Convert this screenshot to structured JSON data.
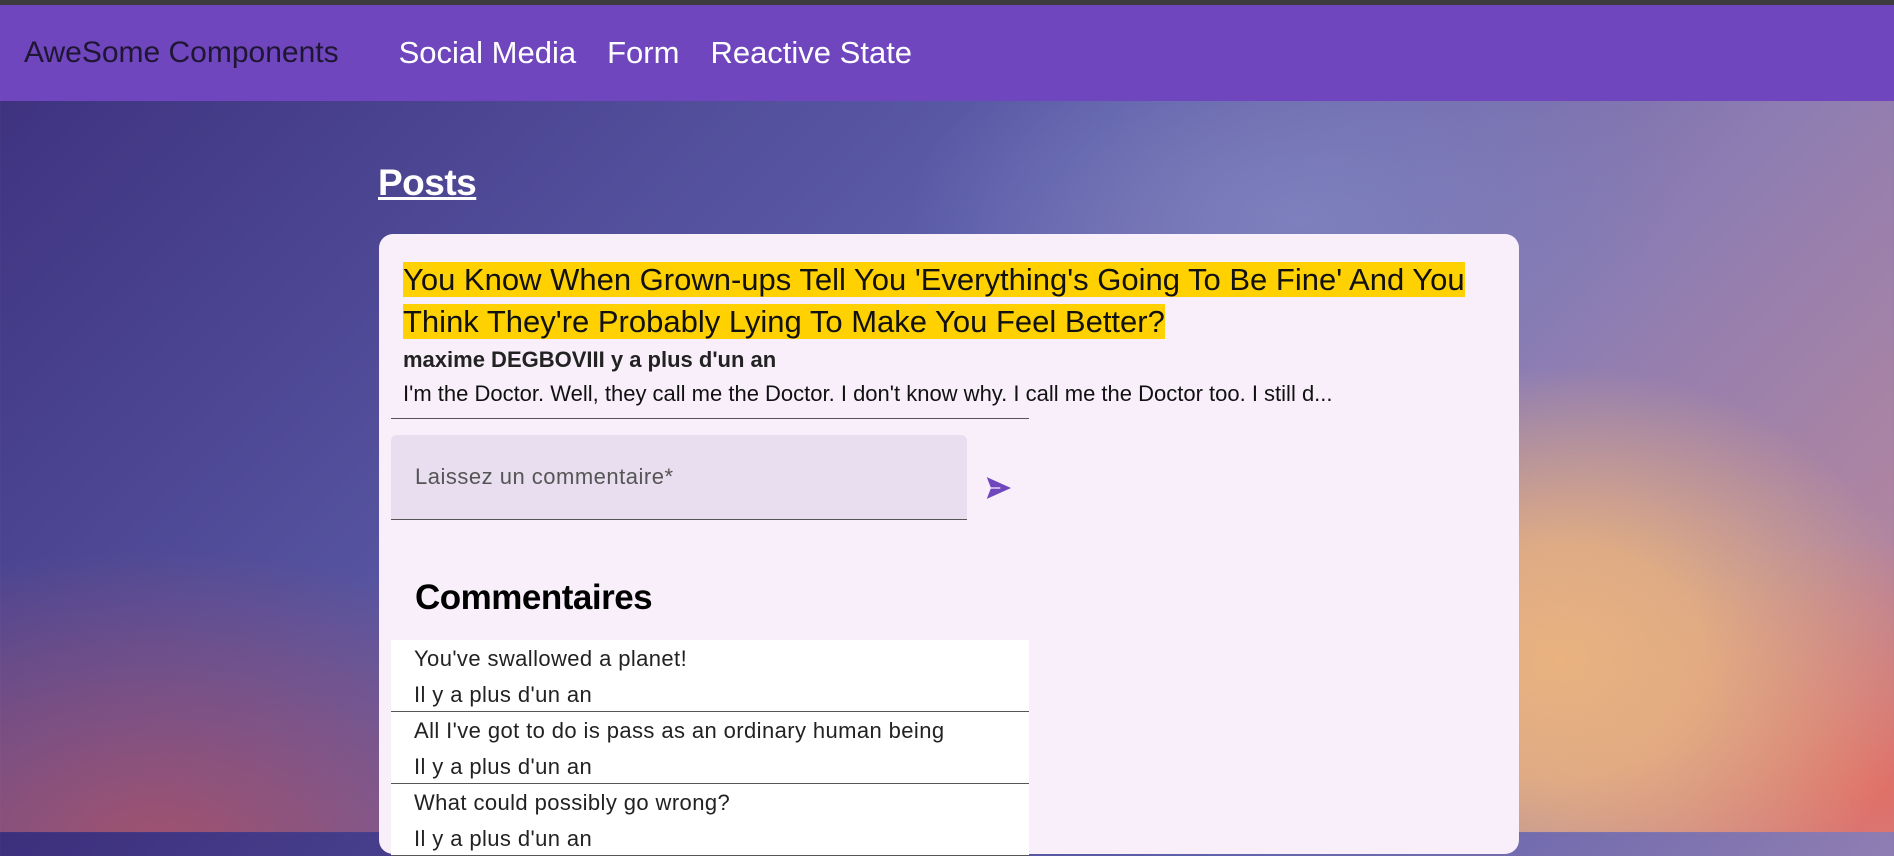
{
  "navbar": {
    "brand": "AweSome Components",
    "links": [
      "Social Media",
      "Form",
      "Reactive State"
    ],
    "color": "#6f46be"
  },
  "main": {
    "heading": "Posts",
    "post": {
      "title": "You Know When Grown-ups Tell You 'Everything's Going To Be Fine' And You Think They're Probably Lying To Make You Feel Better?",
      "author": "maxime DEGBOVIII y a plus d'un an",
      "excerpt": "I'm the Doctor. Well, they call me the Doctor. I don't know why. I call me the Doctor too. I still d...",
      "highlight_color": "#ffd100"
    },
    "comment_form": {
      "placeholder": "Laissez un commentaire*",
      "send_icon": "send-icon"
    },
    "comments": {
      "heading": "Commentaires",
      "items": [
        {
          "text": "You've swallowed a planet!",
          "time": "Il y a plus d'un an"
        },
        {
          "text": "All I've got to do is pass as an ordinary human being",
          "time": "Il y a plus d'un an"
        },
        {
          "text": "What could possibly go wrong?",
          "time": "Il y a plus d'un an"
        }
      ]
    }
  }
}
